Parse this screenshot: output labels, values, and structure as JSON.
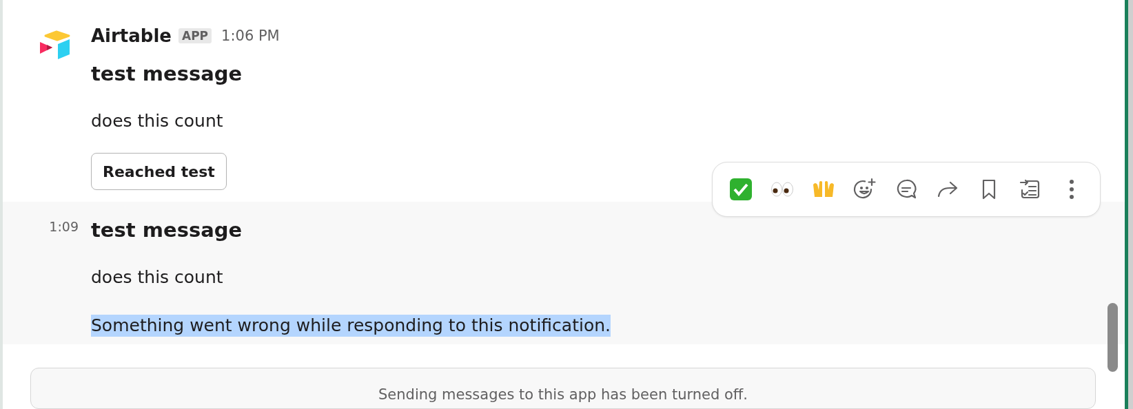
{
  "messages": [
    {
      "kind": "full",
      "sender": "Airtable",
      "badge": "APP",
      "time": "1:06 PM",
      "title": "test message",
      "body": "does this count",
      "button": "Reached test"
    },
    {
      "kind": "continuation",
      "time": "1:09",
      "title": "test message",
      "body": "does this count",
      "notice": "Something went wrong while responding to this notification.",
      "notice_selected": true,
      "hovered": true
    }
  ],
  "composer": {
    "notice": "Sending messages to this app has been turned off."
  }
}
